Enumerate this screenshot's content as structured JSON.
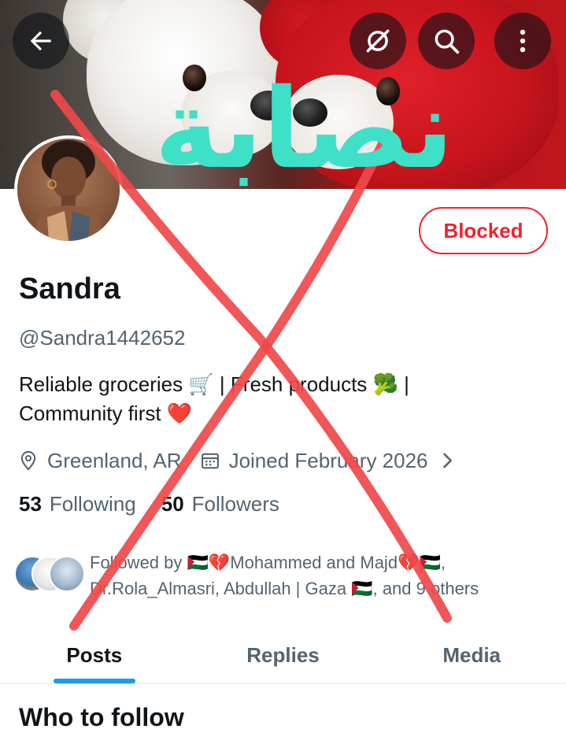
{
  "colors": {
    "accent_blue": "#1d9bf0",
    "blocked_red": "#f4212e",
    "text_primary": "#0f1419",
    "text_secondary": "#536471",
    "overlay_x_red": "#f0484a",
    "overlay_word_teal": "#3ee0c8"
  },
  "header": {
    "back_icon": "arrow-left-icon",
    "notifications_icon": "bell-slash-icon",
    "search_icon": "search-icon",
    "more_icon": "more-vertical-icon"
  },
  "profile": {
    "name": "Sandra",
    "handle": "@Sandra1442652",
    "blocked_label": "Blocked",
    "bio_line1": "Reliable groceries 🛒 | Fresh products 🥦 |",
    "bio_line2": "Community first ❤️",
    "location": "Greenland, AR",
    "joined": "Joined February 2026",
    "following_count": "53",
    "following_label": "Following",
    "followers_count": "50",
    "followers_label": "Followers"
  },
  "followed_by": {
    "line1": "Followed by 🇵🇸💔Mohammed and Majd💔🇵🇸,",
    "line2": "Dr.Rola_Almasri, Abdullah | Gaza 🇵🇸, and 9 others"
  },
  "tabs": [
    {
      "label": "Posts",
      "active": true
    },
    {
      "label": "Replies",
      "active": false
    },
    {
      "label": "Media",
      "active": false
    }
  ],
  "section": {
    "who_to_follow": "Who to follow"
  },
  "overlay": {
    "word": "نصابة"
  }
}
